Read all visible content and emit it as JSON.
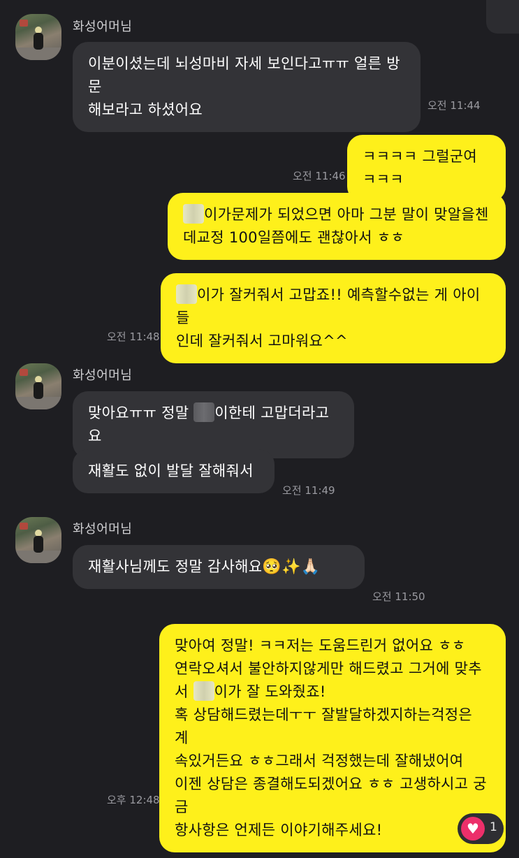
{
  "colors": {
    "background": "#1e1e22",
    "incoming_bubble": "#333337",
    "outgoing_bubble": "#fef01b",
    "reaction_heart": "#ec2f6a"
  },
  "sender_name": "화성어머님",
  "messages": [
    {
      "dir": "in",
      "text": "이분이셨는데 뇌성마비 자세 보인다고ㅠㅠ 얼른 방문\n해보라고 하셨어요",
      "time": "오전 11:44"
    },
    {
      "dir": "out",
      "text": "ㅋㅋㅋㅋ 그럴군여 ㅋㅋㅋ",
      "time": "오전 11:46"
    },
    {
      "dir": "out",
      "text_after_blur": "이가문제가 되었으면 아마 그분 말이 맞알을첸\n데교정 100일쯤에도 괜찮아서 ㅎㅎ"
    },
    {
      "dir": "out",
      "text_after_blur": "이가 잘커줘서 고맙죠!! 예측할수없는 게 아이들\n인데 잘커줘서 고마워요^^",
      "time": "오전 11:48"
    },
    {
      "dir": "in",
      "text_before_blur": "맞아요ㅠㅠ 정말 ",
      "text_after_blur": "이한테 고맙더라고요"
    },
    {
      "dir": "in",
      "text": "재활도 없이 발달 잘해줘서",
      "time": "오전 11:49"
    },
    {
      "dir": "in",
      "text": "재활사님께도 정말 감사해요",
      "emoji": "🥺✨🙏🏻",
      "time": "오전 11:50"
    },
    {
      "dir": "out",
      "text_before_blur": "맞아여 정말! ㅋㅋ저는 도움드린거 없어요 ㅎㅎ\n연락오셔서 불안하지않게만 해드렸고 그거에 맞추\n서 ",
      "text_after_blur": "이가 잘 도와줬죠!\n혹 상담해드렸는데ㅜㅜ 잘발달하겠지하는걱정은 계\n속있거든요 ㅎㅎ그래서 걱정했는데 잘해냈어여\n이젠 상담은 종결해도되겠어요 ㅎㅎ 고생하시고 궁금\n항사항은 언제든 이야기해주세요!",
      "time": "오후 12:48"
    }
  ],
  "reaction": {
    "icon": "heart-icon",
    "symbol": "♥",
    "count": "1"
  }
}
